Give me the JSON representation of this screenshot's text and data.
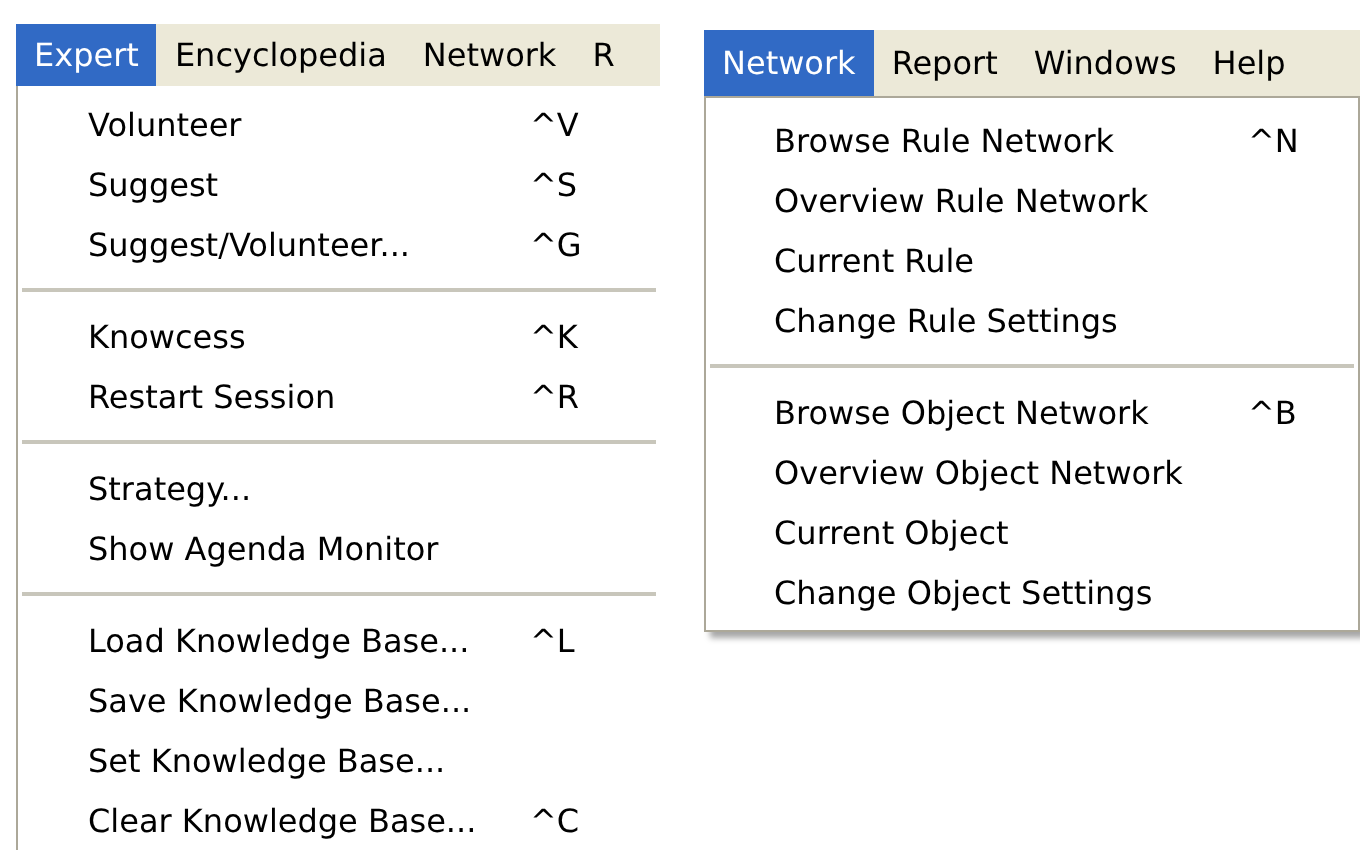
{
  "panels": [
    {
      "menubar": [
        {
          "label": "Expert",
          "selected": true
        },
        {
          "label": "Encyclopedia",
          "selected": false
        },
        {
          "label": "Network",
          "selected": false
        },
        {
          "label": "R",
          "selected": false
        }
      ],
      "menu": {
        "sections": [
          {
            "items": [
              {
                "label": "Volunteer",
                "shortcut": "^V"
              },
              {
                "label": "Suggest",
                "shortcut": "^S"
              },
              {
                "label": "Suggest/Volunteer...",
                "shortcut": "^G"
              }
            ]
          },
          {
            "items": [
              {
                "label": "Knowcess",
                "shortcut": "^K"
              },
              {
                "label": "Restart Session",
                "shortcut": "^R"
              }
            ]
          },
          {
            "items": [
              {
                "label": "Strategy..."
              },
              {
                "label": "Show Agenda Monitor"
              }
            ]
          },
          {
            "items": [
              {
                "label": "Load Knowledge Base...",
                "shortcut": "^L"
              },
              {
                "label": "Save Knowledge Base..."
              },
              {
                "label": "Set Knowledge Base..."
              },
              {
                "label": "Clear Knowledge Base...",
                "shortcut": "^C"
              }
            ]
          }
        ]
      }
    },
    {
      "menubar": [
        {
          "label": "Network",
          "selected": true
        },
        {
          "label": "Report",
          "selected": false
        },
        {
          "label": "Windows",
          "selected": false
        },
        {
          "label": "Help",
          "selected": false
        }
      ],
      "menu": {
        "sections": [
          {
            "items": [
              {
                "label": "Browse Rule Network",
                "shortcut": "^N"
              },
              {
                "label": "Overview Rule Network"
              },
              {
                "label": "Current Rule"
              },
              {
                "label": "Change Rule Settings"
              }
            ]
          },
          {
            "items": [
              {
                "label": "Browse Object Network",
                "shortcut": "^B"
              },
              {
                "label": "Overview Object Network"
              },
              {
                "label": "Current Object"
              },
              {
                "label": "Change Object Settings"
              }
            ]
          }
        ]
      }
    }
  ]
}
